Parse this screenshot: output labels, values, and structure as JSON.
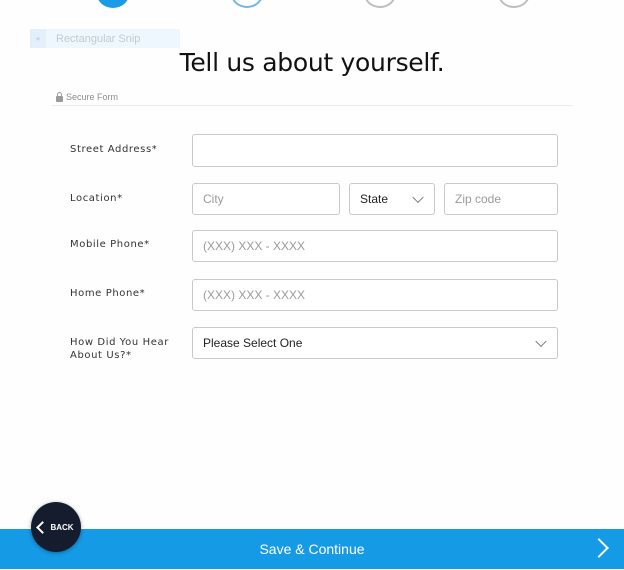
{
  "progress": {
    "steps": [
      "complete",
      "current",
      "pending",
      "pending"
    ]
  },
  "snip_tool": {
    "label": "Rectangular Snip"
  },
  "page": {
    "title": "Tell us about yourself.",
    "secure_label": "Secure Form"
  },
  "form": {
    "street_address": {
      "label": "Street Address*",
      "value": ""
    },
    "location": {
      "label": "Location*",
      "city_placeholder": "City",
      "state_value": "State",
      "zip_placeholder": "Zip code"
    },
    "mobile_phone": {
      "label": "Mobile Phone*",
      "placeholder": "(XXX) XXX - XXXX"
    },
    "home_phone": {
      "label": "Home Phone*",
      "placeholder": "(XXX) XXX - XXXX"
    },
    "referral": {
      "label": "How Did You Hear About Us?*",
      "value": "Please Select One"
    }
  },
  "footer": {
    "save_label": "Save & Continue",
    "back_label": "BACK"
  },
  "colors": {
    "primary": "#159be6",
    "back_button": "#141c2e"
  }
}
